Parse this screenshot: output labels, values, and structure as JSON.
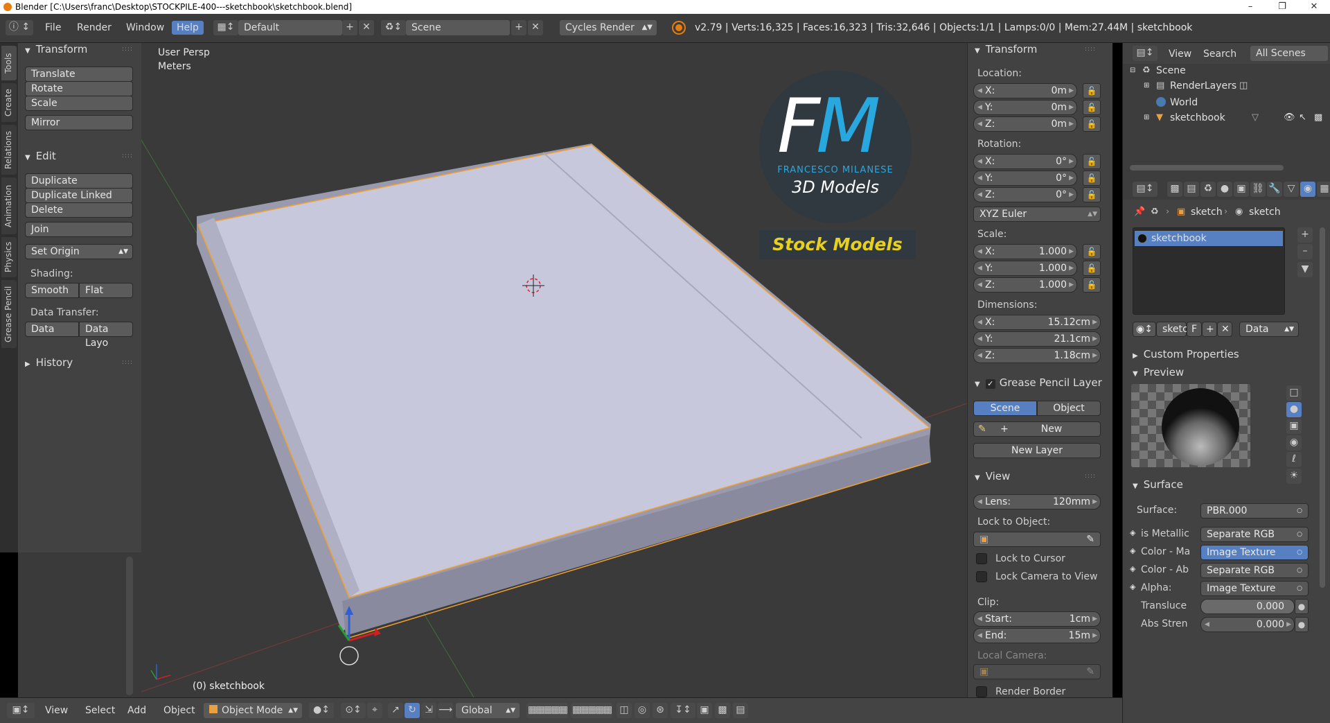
{
  "window": {
    "title": "Blender [C:\\Users\\franc\\Desktop\\STOCKPILE-400---sketchbook\\sketchbook.blend]",
    "minimize": "–",
    "maximize": "❐",
    "close": "✕"
  },
  "info_header": {
    "menus": [
      "File",
      "Render",
      "Window",
      "Help"
    ],
    "screen_layout": "Default",
    "scene": "Scene",
    "render_engine": "Cycles Render",
    "stats": "v2.79 | Verts:16,325 | Faces:16,323 | Tris:32,646 | Objects:1/1 | Lamps:0/0 | Mem:27.44M | sketchbook"
  },
  "left_tabs": [
    "Tools",
    "Create",
    "Relations",
    "Animation",
    "Physics",
    "Grease Pencil"
  ],
  "toolshelf": {
    "transform_title": "Transform",
    "transform_buttons": [
      "Translate",
      "Rotate",
      "Scale",
      "Mirror"
    ],
    "edit_title": "Edit",
    "edit_buttons": [
      "Duplicate",
      "Duplicate Linked",
      "Delete",
      "Join"
    ],
    "set_origin": "Set Origin",
    "shading_label": "Shading:",
    "smooth": "Smooth",
    "flat": "Flat",
    "data_transfer_label": "Data Transfer:",
    "data": "Data",
    "data_layout": "Data Layo",
    "history_title": "History"
  },
  "viewport": {
    "view_name": "User Persp",
    "units": "Meters",
    "object_label": "(0) sketchbook",
    "logo": {
      "letters": "FM",
      "name": "FRANCESCO MILANESE",
      "subtitle": "3D Models",
      "banner": "Stock Models"
    }
  },
  "bottom_bar": {
    "menus": [
      "View",
      "Select",
      "Add",
      "Object"
    ],
    "mode": "Object Mode",
    "orientation": "Global"
  },
  "n_panel": {
    "transform_title": "Transform",
    "location_label": "Location:",
    "location": [
      {
        "k": "X:",
        "v": "0m"
      },
      {
        "k": "Y:",
        "v": "0m"
      },
      {
        "k": "Z:",
        "v": "0m"
      }
    ],
    "rotation_label": "Rotation:",
    "rotation": [
      {
        "k": "X:",
        "v": "0°"
      },
      {
        "k": "Y:",
        "v": "0°"
      },
      {
        "k": "Z:",
        "v": "0°"
      }
    ],
    "rotation_mode": "XYZ Euler",
    "scale_label": "Scale:",
    "scale": [
      {
        "k": "X:",
        "v": "1.000"
      },
      {
        "k": "Y:",
        "v": "1.000"
      },
      {
        "k": "Z:",
        "v": "1.000"
      }
    ],
    "dimensions_label": "Dimensions:",
    "dimensions": [
      {
        "k": "X:",
        "v": "15.12cm"
      },
      {
        "k": "Y:",
        "v": "21.1cm"
      },
      {
        "k": "Z:",
        "v": "1.18cm"
      }
    ],
    "grease_title": "Grease Pencil Layer",
    "scene_btn": "Scene",
    "object_btn": "Object",
    "new_btn": "New",
    "new_layer_btn": "New Layer",
    "view_title": "View",
    "lens_label": "Lens:",
    "lens_value": "120mm",
    "lock_to_object": "Lock to Object:",
    "lock_to_cursor": "Lock to Cursor",
    "lock_camera": "Lock Camera to View",
    "clip_label": "Clip:",
    "clip_start_k": "Start:",
    "clip_start_v": "1cm",
    "clip_end_k": "End:",
    "clip_end_v": "15m",
    "local_camera": "Local Camera:",
    "render_border": "Render Border"
  },
  "outliner": {
    "view": "View",
    "search": "Search",
    "filter": "All Scenes",
    "items": [
      "Scene",
      "RenderLayers",
      "World",
      "sketchbook"
    ]
  },
  "properties": {
    "breadcrumb_1": "sketch",
    "breadcrumb_2": "sketch",
    "material_slot": "sketchbook",
    "datablock": "sketc",
    "fake_user": "F",
    "link": "Data",
    "custom_props": "Custom Properties",
    "preview": "Preview",
    "surface_title": "Surface",
    "surface_label": "Surface:",
    "surface_value": "PBR.000",
    "inputs": [
      {
        "k": "is Metallic",
        "v": "Separate RGB"
      },
      {
        "k": "Color - Ma",
        "v": "Image Texture"
      },
      {
        "k": "Color - Ab",
        "v": "Separate RGB"
      },
      {
        "k": "Alpha:",
        "v": "Image Texture"
      }
    ],
    "translucency_k": "Transluce",
    "translucency_v": "0.000",
    "abs_strength_k": "Abs Stren",
    "abs_strength_v": "0.000"
  },
  "colors": {
    "accent_blue": "#5680c2",
    "selection_orange": "#f0a030",
    "logo_blue": "#29a8e0",
    "banner_yellow": "#e8d020"
  }
}
